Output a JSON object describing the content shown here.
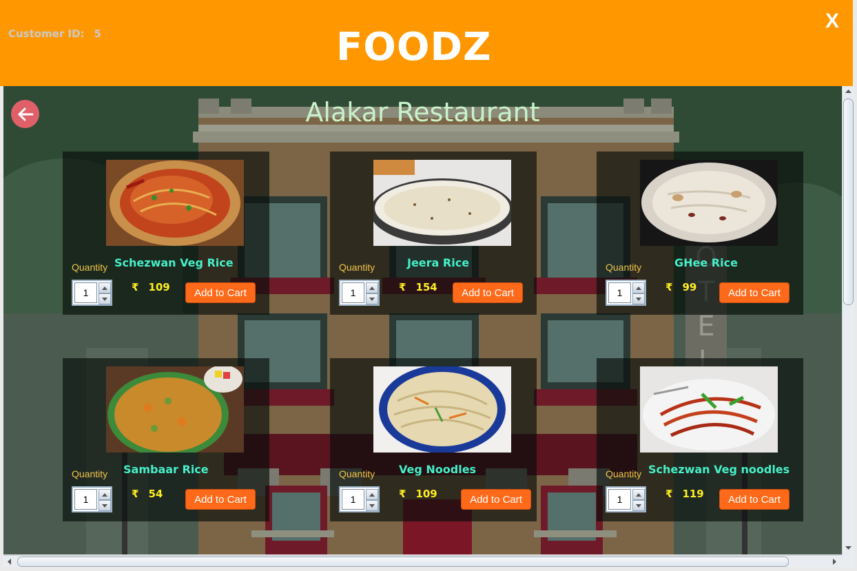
{
  "header": {
    "customer_label": "Customer ID:",
    "customer_id": "5",
    "app_name": "FOODZ",
    "close_label": "X"
  },
  "page": {
    "restaurant_name": "Alakar Restaurant",
    "background_sign_letters": [
      "O",
      "T",
      "E",
      "L"
    ]
  },
  "items": [
    {
      "name": "Schezwan Veg Rice",
      "currency": "₹",
      "price": "109",
      "quantity_label": "Quantity",
      "quantity": "1",
      "button": "Add to Cart"
    },
    {
      "name": "Jeera Rice",
      "currency": "₹",
      "price": "154",
      "quantity_label": "Quantity",
      "quantity": "1",
      "button": "Add to Cart"
    },
    {
      "name": "GHee Rice",
      "currency": "₹",
      "price": "99",
      "quantity_label": "Quantity",
      "quantity": "1",
      "button": "Add to Cart"
    },
    {
      "name": "Sambaar Rice",
      "currency": "₹",
      "price": "54",
      "quantity_label": "Quantity",
      "quantity": "1",
      "button": "Add to Cart"
    },
    {
      "name": "Veg Noodles",
      "currency": "₹",
      "price": "109",
      "quantity_label": "Quantity",
      "quantity": "1",
      "button": "Add to Cart"
    },
    {
      "name": "Schezwan Veg noodles",
      "currency": "₹",
      "price": "119",
      "quantity_label": "Quantity",
      "quantity": "1",
      "button": "Add to Cart"
    }
  ],
  "colors": {
    "header_bg": "#ff9800",
    "content_bg": "#2f4a35",
    "title_text": "#c8f2c8",
    "dish_name": "#46f0c8",
    "price": "#ffee22",
    "quantity_label": "#f0c44a",
    "button_bg": "#ff6a1a",
    "back_button": "#e0606a"
  },
  "icons": {
    "back": "arrow-left-icon",
    "close": "close-icon",
    "spinner_up": "chevron-up-icon",
    "spinner_down": "chevron-down-icon"
  }
}
